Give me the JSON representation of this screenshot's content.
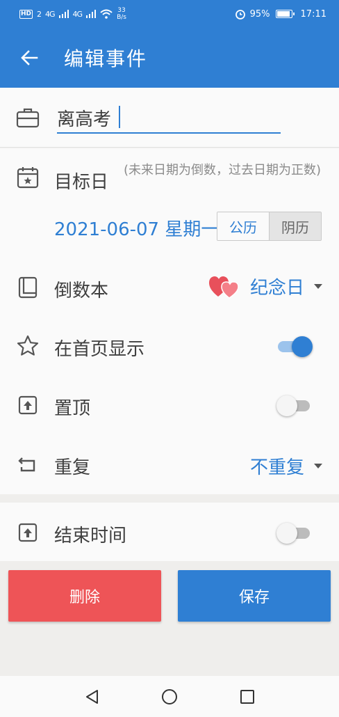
{
  "status_bar": {
    "hd": "HD",
    "hd_sub": "2",
    "signal1": "4G",
    "signal2": "4G",
    "speed_value": "33",
    "speed_unit": "B/s",
    "battery": "95%",
    "time": "17:11"
  },
  "app_bar": {
    "title": "编辑事件"
  },
  "name_field": {
    "value": "离高考"
  },
  "target_date": {
    "label": "目标日",
    "hint": "(未来日期为倒数，过去日期为正数)",
    "date": "2021-06-07 星期一",
    "calendar_solar": "公历",
    "calendar_lunar": "阴历"
  },
  "book": {
    "label": "倒数本",
    "value": "纪念日"
  },
  "show_home": {
    "label": "在首页显示",
    "enabled": true
  },
  "pin_top": {
    "label": "置顶",
    "enabled": false
  },
  "repeat": {
    "label": "重复",
    "value": "不重复"
  },
  "end_time": {
    "label": "结束时间",
    "enabled": false
  },
  "actions": {
    "delete_label": "删除",
    "save_label": "保存"
  },
  "colors": {
    "primary": "#2f7fd3",
    "danger": "#ee5457"
  }
}
